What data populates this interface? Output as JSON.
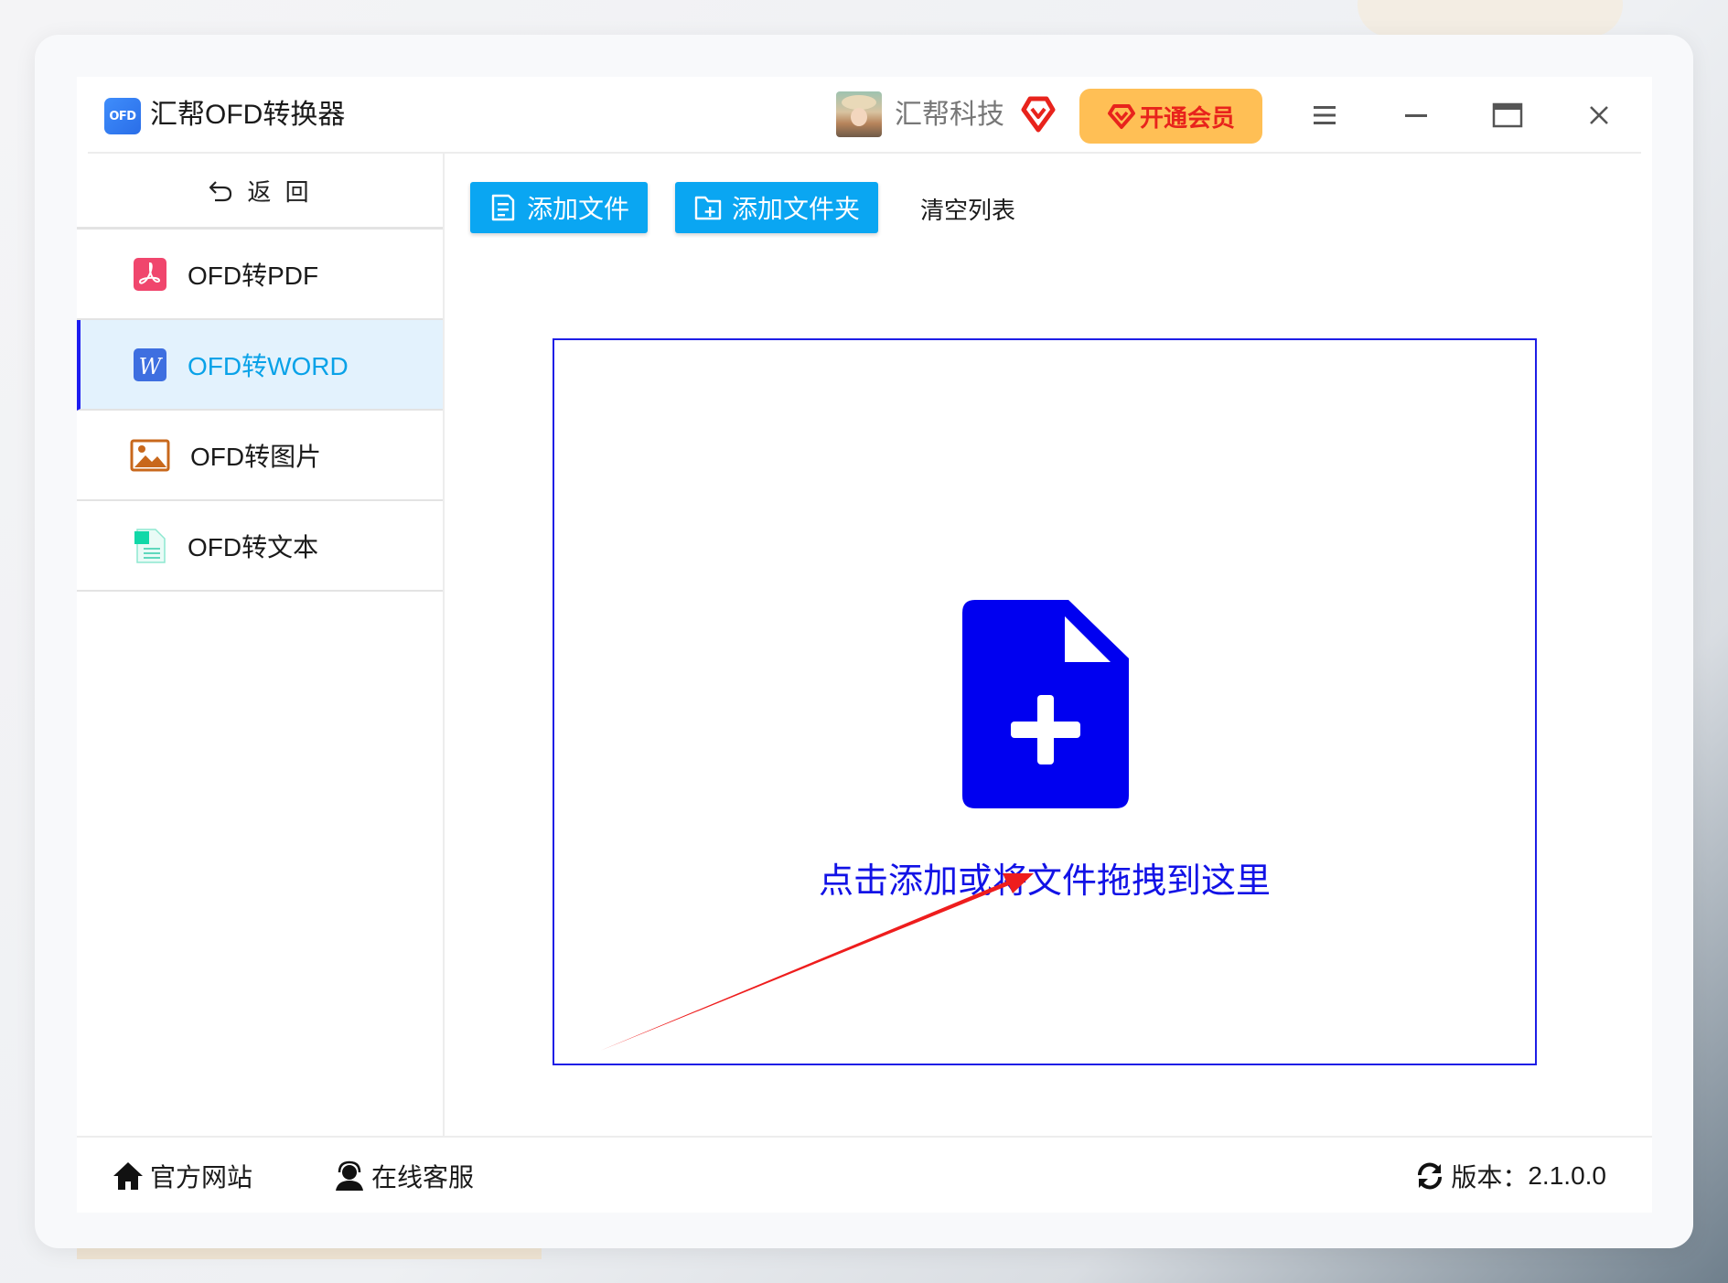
{
  "app": {
    "logo_text": "OFD",
    "title": "汇帮OFD转换器",
    "accent_color": "#09a2e8",
    "drop_color": "#1212e6"
  },
  "header": {
    "username": "汇帮科技",
    "vip_button_label": "开通会员",
    "icons": [
      "avatar",
      "vip-diamond-icon",
      "menu-icon",
      "minimize-icon",
      "maximize-icon",
      "close-icon"
    ]
  },
  "sidebar": {
    "back_label": "返 回",
    "items": [
      {
        "label": "OFD转PDF",
        "icon": "pdf-icon",
        "active": false
      },
      {
        "label": "OFD转WORD",
        "icon": "word-icon",
        "active": true
      },
      {
        "label": "OFD转图片",
        "icon": "image-icon",
        "active": false
      },
      {
        "label": "OFD转文本",
        "icon": "text-file-icon",
        "active": false
      }
    ]
  },
  "toolbar": {
    "add_file_label": "添加文件",
    "add_folder_label": "添加文件夹",
    "clear_list_label": "清空列表"
  },
  "dropzone": {
    "text": "点击添加或将文件拖拽到这里",
    "icon": "add-file-icon"
  },
  "footer": {
    "website_label": "官方网站",
    "support_label": "在线客服",
    "version_label": "版本：",
    "version_value": "2.1.0.0"
  }
}
